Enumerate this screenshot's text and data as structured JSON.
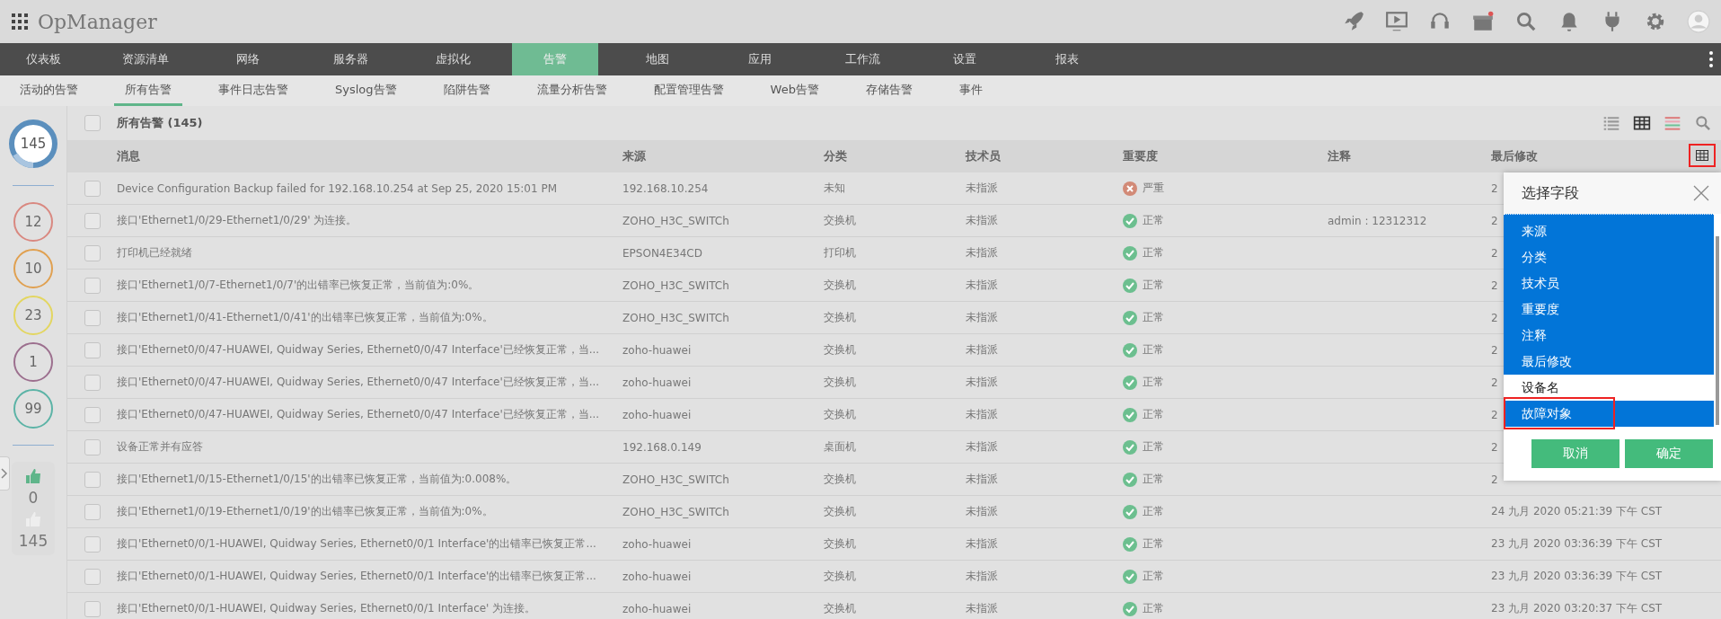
{
  "app": {
    "title": "OpManager"
  },
  "header_icons": [
    {
      "kind": "rocket"
    },
    {
      "kind": "monitor"
    },
    {
      "kind": "headset"
    },
    {
      "kind": "gift"
    },
    {
      "kind": "search"
    },
    {
      "kind": "bell"
    },
    {
      "kind": "plug"
    },
    {
      "kind": "gear"
    },
    {
      "kind": "avatar"
    }
  ],
  "nav": [
    {
      "label": "仪表板",
      "selected": false
    },
    {
      "label": "资源清单",
      "selected": false
    },
    {
      "label": "网络",
      "selected": false
    },
    {
      "label": "服务器",
      "selected": false
    },
    {
      "label": "虚拟化",
      "selected": false
    },
    {
      "label": "告警",
      "selected": true
    },
    {
      "label": "地图",
      "selected": false
    },
    {
      "label": "应用",
      "selected": false
    },
    {
      "label": "工作流",
      "selected": false
    },
    {
      "label": "设置",
      "selected": false
    },
    {
      "label": "报表",
      "selected": false
    }
  ],
  "subnav": [
    {
      "label": "活动的告警",
      "selected": false
    },
    {
      "label": "所有告警",
      "selected": true
    },
    {
      "label": "事件日志告警",
      "selected": false
    },
    {
      "label": "Syslog告警",
      "selected": false
    },
    {
      "label": "陷阱告警",
      "selected": false
    },
    {
      "label": "流量分析告警",
      "selected": false
    },
    {
      "label": "配置管理告警",
      "selected": false
    },
    {
      "label": "Web告警",
      "selected": false
    },
    {
      "label": "存储告警",
      "selected": false
    },
    {
      "label": "事件",
      "selected": false
    }
  ],
  "summary": {
    "total": "145",
    "severities": [
      {
        "count": "12",
        "color": "#d98880"
      },
      {
        "count": "10",
        "color": "#e0a050"
      },
      {
        "count": "23",
        "color": "#e3d660"
      },
      {
        "count": "1",
        "color": "#9c6f8e"
      },
      {
        "count": "99",
        "color": "#5bb3a6"
      }
    ],
    "acknowledged": "0",
    "unacknowledged": "145"
  },
  "table": {
    "title": "所有告警 (145)",
    "select_all_checked": false,
    "view_icons": [
      {
        "kind": "list",
        "selected": false
      },
      {
        "kind": "grid",
        "selected": true
      },
      {
        "kind": "colored-list",
        "selected": false
      },
      {
        "kind": "search",
        "selected": false
      }
    ],
    "columns": [
      "消息",
      "来源",
      "分类",
      "技术员",
      "重要度",
      "注释",
      "最后修改"
    ],
    "column_button": {
      "highlighted": true
    },
    "rows": [
      {
        "checked": false,
        "message": "Device Configuration Backup failed for 192.168.10.254 at Sep 25, 2020 15:01 PM",
        "source": "192.168.10.254",
        "category": "未知",
        "technician": "未指派",
        "severity": {
          "kind": "critical",
          "label": "严重"
        },
        "last_modified": "2"
      },
      {
        "checked": false,
        "message": "接口'Ethernet1/0/29-Ethernet1/0/29' 为连接。",
        "source": "ZOHO_H3C_SWITCh",
        "category": "交换机",
        "technician": "未指派",
        "severity": {
          "kind": "clear",
          "label": "正常"
        },
        "notes": "admin : 12312312",
        "last_modified": "2"
      },
      {
        "checked": false,
        "message": "打印机已经就绪",
        "source": "EPSON4E34CD",
        "category": "打印机",
        "technician": "未指派",
        "severity": {
          "kind": "clear",
          "label": "正常"
        },
        "last_modified": "2"
      },
      {
        "checked": false,
        "message": "接口'Ethernet1/0/7-Ethernet1/0/7'的出错率已恢复正常，当前值为:0%。",
        "source": "ZOHO_H3C_SWITCh",
        "category": "交换机",
        "technician": "未指派",
        "severity": {
          "kind": "clear",
          "label": "正常"
        },
        "last_modified": "2"
      },
      {
        "checked": false,
        "message": "接口'Ethernet1/0/41-Ethernet1/0/41'的出错率已恢复正常，当前值为:0%。",
        "source": "ZOHO_H3C_SWITCh",
        "category": "交换机",
        "technician": "未指派",
        "severity": {
          "kind": "clear",
          "label": "正常"
        },
        "last_modified": "2"
      },
      {
        "checked": false,
        "message": "接口'Ethernet0/0/47-HUAWEI, Quidway Series, Ethernet0/0/47 Interface'已经恢复正常，当...",
        "source": "zoho-huawei",
        "category": "交换机",
        "technician": "未指派",
        "severity": {
          "kind": "clear",
          "label": "正常"
        },
        "last_modified": "2"
      },
      {
        "checked": false,
        "message": "接口'Ethernet0/0/47-HUAWEI, Quidway Series, Ethernet0/0/47 Interface'已经恢复正常，当...",
        "source": "zoho-huawei",
        "category": "交换机",
        "technician": "未指派",
        "severity": {
          "kind": "clear",
          "label": "正常"
        },
        "last_modified": "2"
      },
      {
        "checked": false,
        "message": "接口'Ethernet0/0/47-HUAWEI, Quidway Series, Ethernet0/0/47 Interface'已经恢复正常，当...",
        "source": "zoho-huawei",
        "category": "交换机",
        "technician": "未指派",
        "severity": {
          "kind": "clear",
          "label": "正常"
        },
        "last_modified": "2"
      },
      {
        "checked": false,
        "message": "设备正常并有应答",
        "source": "192.168.0.149",
        "category": "桌面机",
        "technician": "未指派",
        "severity": {
          "kind": "clear",
          "label": "正常"
        },
        "last_modified": "2"
      },
      {
        "checked": false,
        "message": "接口'Ethernet1/0/15-Ethernet1/0/15'的出错率已恢复正常，当前值为:0.008%。",
        "source": "ZOHO_H3C_SWITCh",
        "category": "交换机",
        "technician": "未指派",
        "severity": {
          "kind": "clear",
          "label": "正常"
        },
        "last_modified": "2"
      },
      {
        "checked": false,
        "message": "接口'Ethernet1/0/19-Ethernet1/0/19'的出错率已恢复正常，当前值为:0%。",
        "source": "ZOHO_H3C_SWITCh",
        "category": "交换机",
        "technician": "未指派",
        "severity": {
          "kind": "clear",
          "label": "正常"
        },
        "last_modified": "24 九月 2020 05:21:39 下午 CST"
      },
      {
        "checked": false,
        "message": "接口'Ethernet0/0/1-HUAWEI, Quidway Series, Ethernet0/0/1 Interface'的出错率已恢复正常...",
        "source": "zoho-huawei",
        "category": "交换机",
        "technician": "未指派",
        "severity": {
          "kind": "clear",
          "label": "正常"
        },
        "last_modified": "23 九月 2020 03:36:39 下午 CST"
      },
      {
        "checked": false,
        "message": "接口'Ethernet0/0/1-HUAWEI, Quidway Series, Ethernet0/0/1 Interface'的出错率已恢复正常...",
        "source": "zoho-huawei",
        "category": "交换机",
        "technician": "未指派",
        "severity": {
          "kind": "clear",
          "label": "正常"
        },
        "last_modified": "23 九月 2020 03:36:39 下午 CST"
      },
      {
        "checked": false,
        "message": "接口'Ethernet0/0/1-HUAWEI, Quidway Series, Ethernet0/0/1 Interface' 为连接。",
        "source": "zoho-huawei",
        "category": "交换机",
        "technician": "未指派",
        "severity": {
          "kind": "clear",
          "label": "正常"
        },
        "last_modified": "23 九月 2020 03:20:37 下午 CST"
      }
    ]
  },
  "field_picker": {
    "title": "选择字段",
    "items": [
      {
        "label": "来源",
        "selected": true,
        "highlighted": false
      },
      {
        "label": "分类",
        "selected": true,
        "highlighted": false
      },
      {
        "label": "技术员",
        "selected": true,
        "highlighted": false
      },
      {
        "label": "重要度",
        "selected": true,
        "highlighted": false
      },
      {
        "label": "注释",
        "selected": true,
        "highlighted": false
      },
      {
        "label": "最后修改",
        "selected": true,
        "highlighted": false
      },
      {
        "label": "设备名",
        "selected": false,
        "highlighted": false
      },
      {
        "label": "故障对象",
        "selected": true,
        "highlighted": true
      }
    ],
    "buttons": [
      "取消",
      "确定"
    ]
  }
}
